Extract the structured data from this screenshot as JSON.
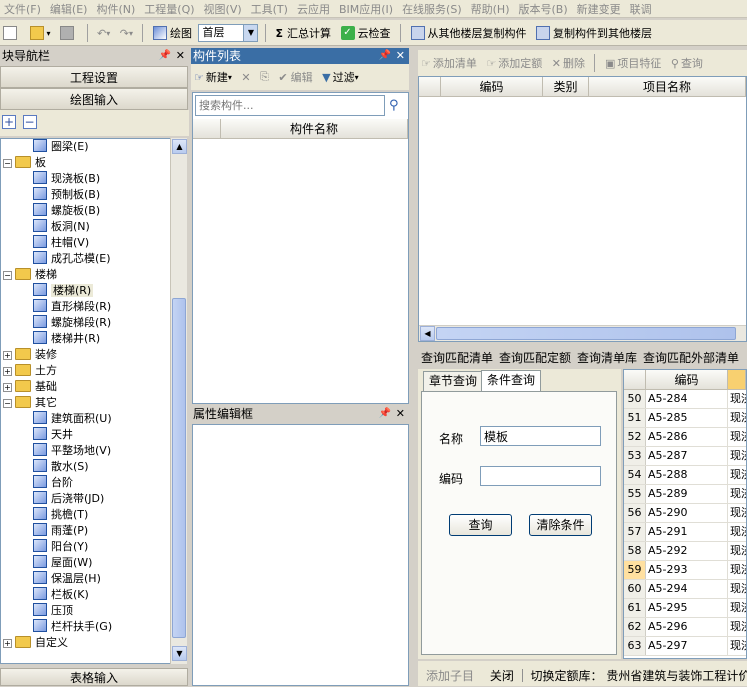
{
  "menu": [
    "文件(F)",
    "编辑(E)",
    "构件(N)",
    "工程量(Q)",
    "视图(V)",
    "工具(T)",
    "云应用",
    "BIM应用(I)",
    "在线服务(S)",
    "帮助(H)",
    "版本号(B)",
    "新建变更",
    "联调"
  ],
  "toolbar": {
    "draw_label": "绘图",
    "floor_value": "首层",
    "sum_label": "汇总计算",
    "cloud_check_label": "云检查",
    "copy_from_label": "从其他楼层复制构件",
    "copy_to_label": "复制构件到其他楼层"
  },
  "nav": {
    "title": "块导航栏",
    "project_settings": "工程设置",
    "drawing_input": "绘图输入",
    "table_input": "表格输入",
    "tree": [
      {
        "label": "圈梁(E)",
        "level": 2,
        "icon": "ring-beam-icon"
      },
      {
        "label": "板",
        "level": 1,
        "folder": true,
        "expanded": true
      },
      {
        "label": "现浇板(B)",
        "level": 2,
        "icon": "cast-slab-icon"
      },
      {
        "label": "预制板(B)",
        "level": 2,
        "icon": "precast-slab-icon"
      },
      {
        "label": "螺旋板(B)",
        "level": 2,
        "icon": "spiral-slab-icon"
      },
      {
        "label": "板洞(N)",
        "level": 2,
        "icon": "slab-hole-icon"
      },
      {
        "label": "柱帽(V)",
        "level": 2,
        "icon": "column-cap-icon"
      },
      {
        "label": "成孔芯模(E)",
        "level": 2,
        "icon": "core-mold-icon"
      },
      {
        "label": "楼梯",
        "level": 1,
        "folder": true,
        "expanded": true
      },
      {
        "label": "楼梯(R)",
        "level": 2,
        "icon": "stair-icon",
        "selected": true
      },
      {
        "label": "直形梯段(R)",
        "level": 2,
        "icon": "straight-flight-icon"
      },
      {
        "label": "螺旋梯段(R)",
        "level": 2,
        "icon": "spiral-flight-icon"
      },
      {
        "label": "楼梯井(R)",
        "level": 2,
        "icon": "stairwell-icon"
      },
      {
        "label": "装修",
        "level": 1,
        "folder": true,
        "expanded": false
      },
      {
        "label": "土方",
        "level": 1,
        "folder": true,
        "expanded": false
      },
      {
        "label": "基础",
        "level": 1,
        "folder": true,
        "expanded": false
      },
      {
        "label": "其它",
        "level": 1,
        "folder": true,
        "expanded": true
      },
      {
        "label": "建筑面积(U)",
        "level": 2,
        "icon": "building-area-icon"
      },
      {
        "label": "天井",
        "level": 2,
        "icon": "patio-icon"
      },
      {
        "label": "平整场地(V)",
        "level": 2,
        "icon": "site-leveling-icon"
      },
      {
        "label": "散水(S)",
        "level": 2,
        "icon": "apron-icon"
      },
      {
        "label": "台阶",
        "level": 2,
        "icon": "steps-icon"
      },
      {
        "label": "后浇带(JD)",
        "level": 2,
        "icon": "post-pour-strip-icon"
      },
      {
        "label": "挑檐(T)",
        "level": 2,
        "icon": "eave-icon"
      },
      {
        "label": "雨蓬(P)",
        "level": 2,
        "icon": "canopy-icon"
      },
      {
        "label": "阳台(Y)",
        "level": 2,
        "icon": "balcony-icon"
      },
      {
        "label": "屋面(W)",
        "level": 2,
        "icon": "roof-icon"
      },
      {
        "label": "保温层(H)",
        "level": 2,
        "icon": "insulation-icon"
      },
      {
        "label": "栏板(K)",
        "level": 2,
        "icon": "parapet-icon"
      },
      {
        "label": "压顶",
        "level": 2,
        "icon": "coping-icon"
      },
      {
        "label": "栏杆扶手(G)",
        "level": 2,
        "icon": "railing-icon"
      },
      {
        "label": "自定义",
        "level": 1,
        "folder": true,
        "expanded": false
      }
    ]
  },
  "component_list": {
    "title": "构件列表",
    "new_label": "新建",
    "edit_label": "编辑",
    "filter_label": "过滤",
    "search_placeholder": "搜索构件...",
    "column_name": "构件名称"
  },
  "property_editor": {
    "title": "属性编辑框"
  },
  "right_toolbar": {
    "add_list": "添加清单",
    "add_quota": "添加定额",
    "delete": "删除",
    "item_feature": "项目特征",
    "query": "查询"
  },
  "right_table": {
    "headers": [
      "编码",
      "类别",
      "项目名称"
    ]
  },
  "query_links": [
    "查询匹配清单",
    "查询匹配定额",
    "查询清单库",
    "查询匹配外部清单"
  ],
  "query_tabs": {
    "chapter": "章节查询",
    "condition": "条件查询"
  },
  "query_form": {
    "name_label": "名称",
    "name_value": "模板",
    "code_label": "编码",
    "code_value": "",
    "search_button": "查询",
    "clear_button": "清除条件"
  },
  "results": {
    "code_header": "编码",
    "rows": [
      {
        "num": "50",
        "code": "A5-284",
        "type": "现浇"
      },
      {
        "num": "51",
        "code": "A5-285",
        "type": "现浇"
      },
      {
        "num": "52",
        "code": "A5-286",
        "type": "现浇"
      },
      {
        "num": "53",
        "code": "A5-287",
        "type": "现浇"
      },
      {
        "num": "54",
        "code": "A5-288",
        "type": "现浇"
      },
      {
        "num": "55",
        "code": "A5-289",
        "type": "现浇"
      },
      {
        "num": "56",
        "code": "A5-290",
        "type": "现浇"
      },
      {
        "num": "57",
        "code": "A5-291",
        "type": "现浇"
      },
      {
        "num": "58",
        "code": "A5-292",
        "type": "现浇"
      },
      {
        "num": "59",
        "code": "A5-293",
        "type": "现浇",
        "selected": true
      },
      {
        "num": "60",
        "code": "A5-294",
        "type": "现浇"
      },
      {
        "num": "61",
        "code": "A5-295",
        "type": "现浇"
      },
      {
        "num": "62",
        "code": "A5-296",
        "type": "现浇"
      },
      {
        "num": "63",
        "code": "A5-297",
        "type": "现浇"
      }
    ]
  },
  "statusbar": {
    "add_child": "添加子目",
    "close": "关闭",
    "switch_quota_label": "切换定额库：",
    "quota_library": "贵州省建筑与装饰工程计价定"
  }
}
